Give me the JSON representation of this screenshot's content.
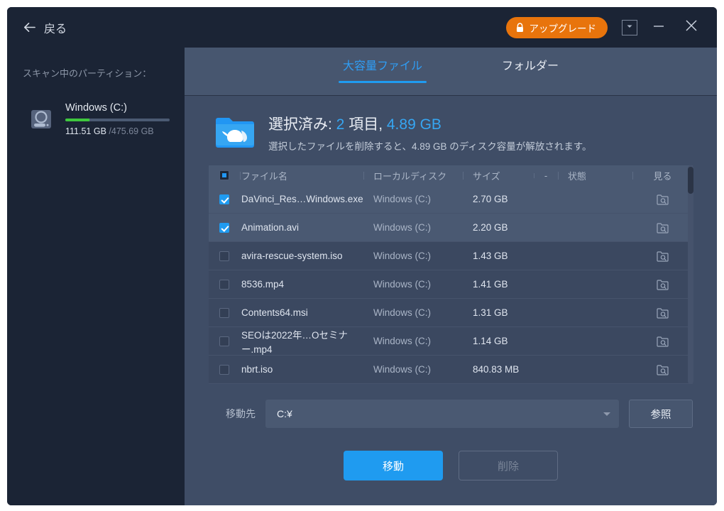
{
  "titlebar": {
    "back_label": "戻る",
    "back_icon": "arrow-left-icon",
    "upgrade_label": "アップグレード",
    "upgrade_icon": "lock-icon",
    "upgrade_color": "#e8740c",
    "caret_icon": "chevron-down-icon",
    "minimize_icon": "minimize-icon",
    "close_icon": "close-icon"
  },
  "sidebar": {
    "title": "スキャン中のパーティション：",
    "disk": {
      "icon": "hard-disk-icon",
      "name": "Windows (C:)",
      "used": "111.51 GB",
      "total": "/475.69 GB",
      "bar_percent": 23.4,
      "bar_color": "#3ec73e"
    }
  },
  "tabs": [
    {
      "label": "大容量ファイル",
      "active": true
    },
    {
      "label": "フォルダー",
      "active": false
    }
  ],
  "accent_color": "#1f9bf0",
  "summary": {
    "icon": "whale-folder-icon",
    "prefix": "選択済み: ",
    "count": "2",
    "mid": " 項目, ",
    "size": "4.89 GB",
    "description": "選択したファイルを削除すると、4.89 GB のディスク容量が解放されます。"
  },
  "table": {
    "headers": {
      "name": "ファイル名",
      "disk": "ローカルディスク",
      "size": "サイズ",
      "sort": "-",
      "state": "状態",
      "view": "見る"
    },
    "header_checkbox": "indeterminate",
    "view_icon": "folder-search-icon",
    "rows": [
      {
        "checked": true,
        "name": "DaVinci_Res…Windows.exe",
        "disk": "Windows (C:)",
        "size": "2.70 GB",
        "state": ""
      },
      {
        "checked": true,
        "name": "Animation.avi",
        "disk": "Windows (C:)",
        "size": "2.20 GB",
        "state": ""
      },
      {
        "checked": false,
        "name": "avira-rescue-system.iso",
        "disk": "Windows (C:)",
        "size": "1.43 GB",
        "state": ""
      },
      {
        "checked": false,
        "name": "8536.mp4",
        "disk": "Windows (C:)",
        "size": "1.41 GB",
        "state": ""
      },
      {
        "checked": false,
        "name": "Contents64.msi",
        "disk": "Windows (C:)",
        "size": "1.31 GB",
        "state": ""
      },
      {
        "checked": false,
        "name": "SEOは2022年…Oセミナー.mp4",
        "disk": "Windows (C:)",
        "size": "1.14 GB",
        "state": ""
      },
      {
        "checked": false,
        "name": "nbrt.iso",
        "disk": "Windows (C:)",
        "size": "840.83 MB",
        "state": ""
      }
    ]
  },
  "destination": {
    "label": "移動先",
    "value": "C:¥",
    "browse_label": "参照",
    "caret_icon": "chevron-down-icon"
  },
  "actions": {
    "move_label": "移動",
    "delete_label": "削除"
  }
}
